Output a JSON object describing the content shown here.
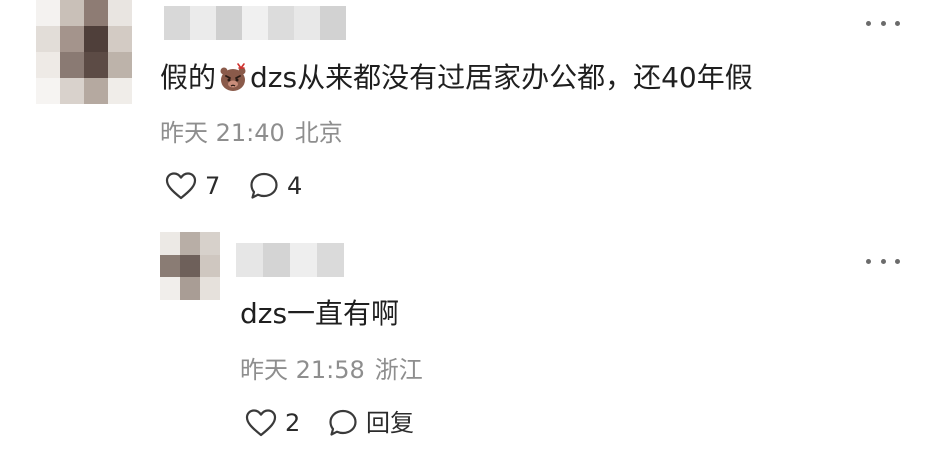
{
  "comment": {
    "avatar_colors": [
      "#f4f2f0",
      "#c9c0b8",
      "#8e7c74",
      "#e9e5e1",
      "#e2ddd8",
      "#a4948c",
      "#4f3f3a",
      "#d3cbc4",
      "#eeeae6",
      "#8a7a73",
      "#5c4b45",
      "#bdb3aa",
      "#f6f4f2",
      "#d9d2cc",
      "#b5a9a0",
      "#f0ede9"
    ],
    "username_blur_colors": [
      "#d8d8d8",
      "#ebebeb",
      "#cfcfcf",
      "#f0f0f0",
      "#dcdcdc",
      "#e8e8e8",
      "#d2d2d2"
    ],
    "text_before": "假的",
    "sticker_icon": "angry-bear-sticker",
    "text_after": "dzs从来都没有过居家办公都，还40年假",
    "time": "昨天 21:40",
    "location": "北京",
    "like_count": "7",
    "reply_count": "4"
  },
  "reply": {
    "avatar_colors": [
      "#ece9e5",
      "#b8aea6",
      "#d7d1cb",
      "#8a7c74",
      "#6e605a",
      "#cfc7c0",
      "#f1eeeb",
      "#a99d95",
      "#e6e1dc"
    ],
    "username_blur_colors": [
      "#e6e6e6",
      "#d4d4d4",
      "#eeeeee",
      "#dadada"
    ],
    "text": "dzs一直有啊",
    "time": "昨天 21:58",
    "location": "浙江",
    "like_count": "2",
    "reply_label": "回复"
  },
  "icons": {
    "more": "more-dots-icon",
    "like": "heart-outline-icon",
    "comment": "speech-bubble-icon"
  }
}
